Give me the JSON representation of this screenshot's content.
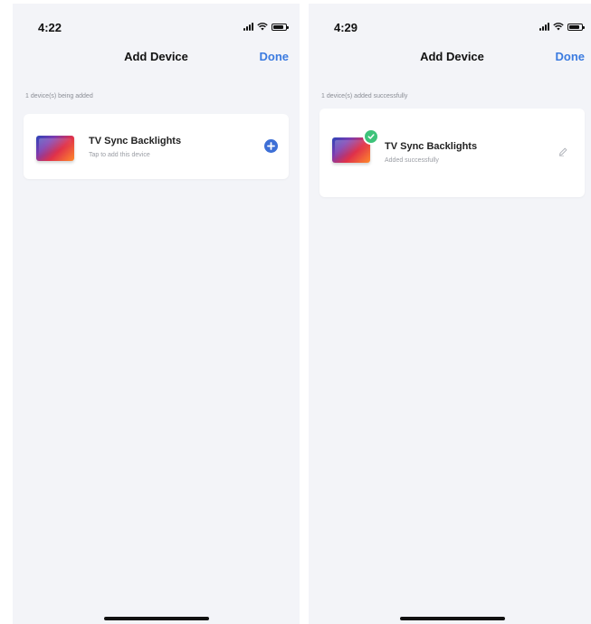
{
  "screens": [
    {
      "status_time": "4:22",
      "nav_title": "Add Device",
      "done_label": "Done",
      "section_note": "1 device(s) being added",
      "device": {
        "name": "TV Sync Backlights",
        "subtitle": "Tap to add this device",
        "action_icon": "plus-circle-icon"
      }
    },
    {
      "status_time": "4:29",
      "nav_title": "Add Device",
      "done_label": "Done",
      "section_note": "1 device(s) added successfully",
      "device": {
        "name": "TV Sync Backlights",
        "subtitle": "Added successfully",
        "action_icon": "edit-pencil-icon",
        "status_icon": "check-circle-icon"
      }
    }
  ],
  "colors": {
    "accent": "#3b7be0",
    "success": "#3ec37a",
    "background": "#f3f4f8"
  }
}
